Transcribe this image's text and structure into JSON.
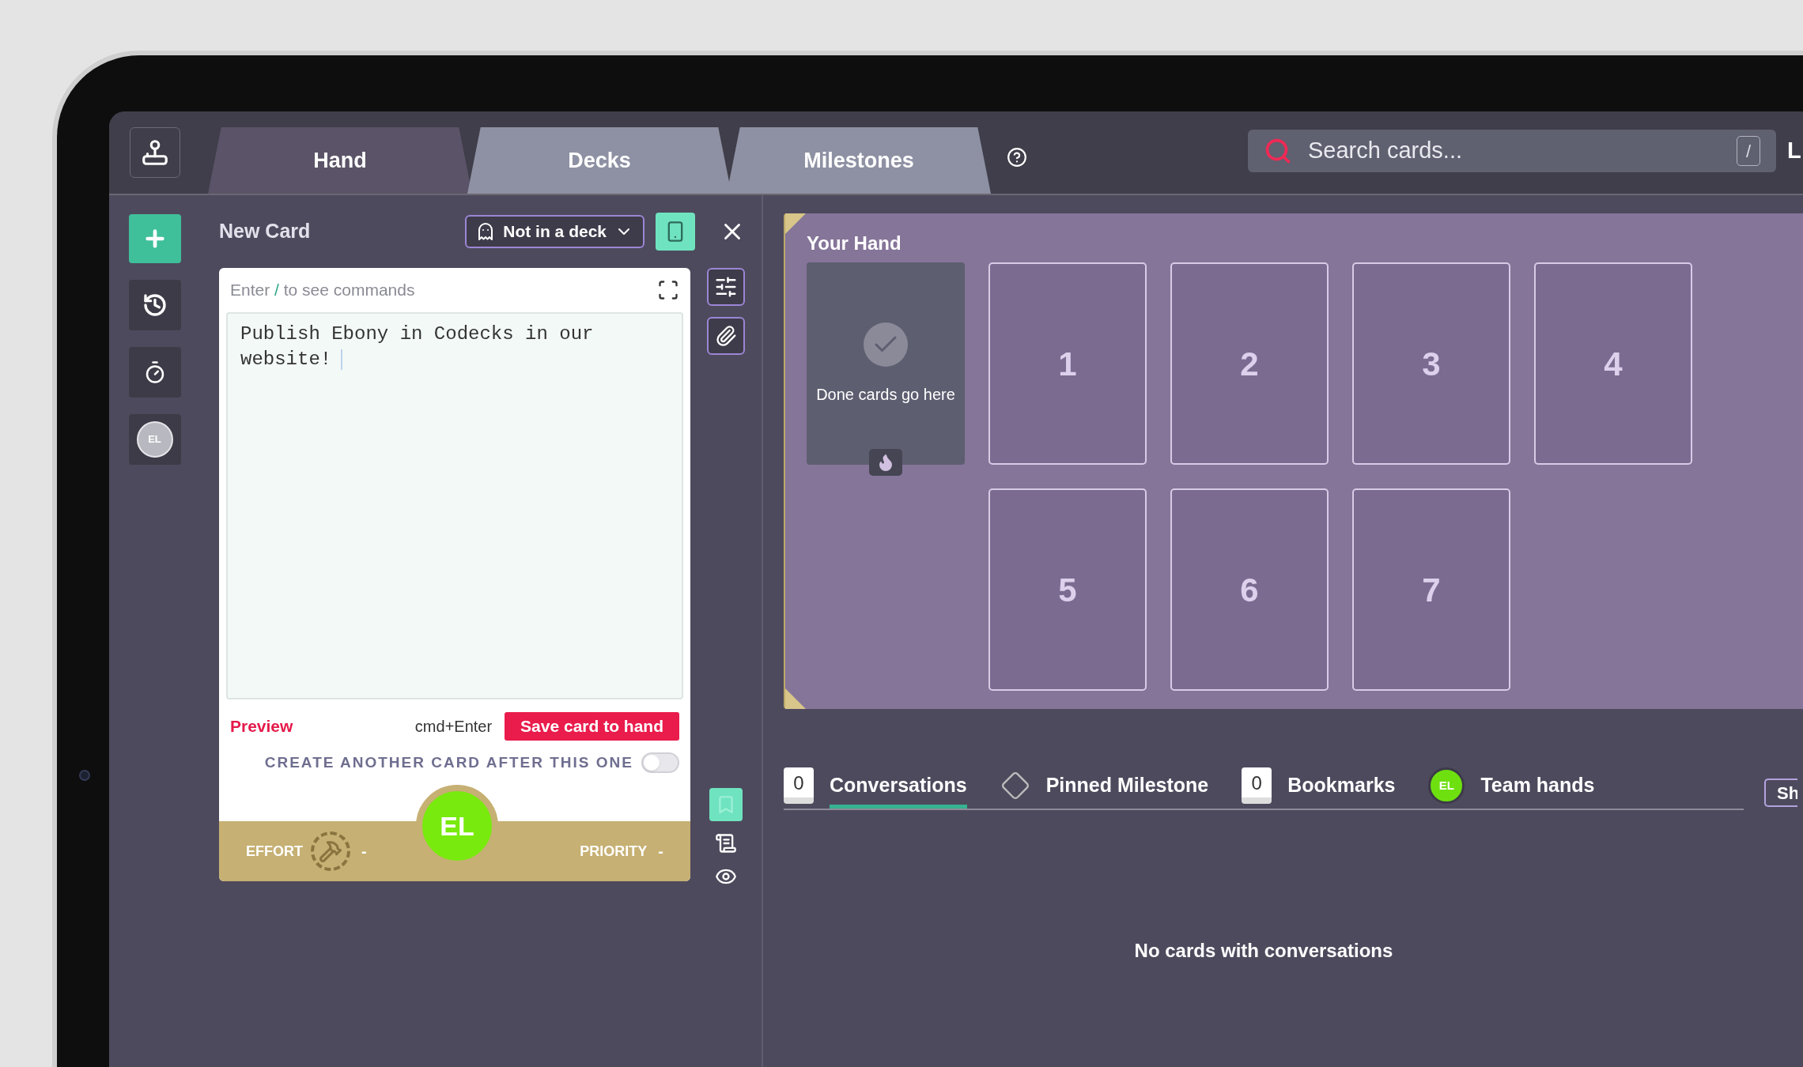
{
  "top_bar": {
    "tabs": [
      {
        "label": "Hand",
        "selected": true
      },
      {
        "label": "Decks",
        "selected": false
      },
      {
        "label": "Milestones",
        "selected": false
      }
    ],
    "search": {
      "placeholder": "Search cards...",
      "shortcut": "/"
    },
    "clipped_label": "L"
  },
  "sidebar": {
    "avatar_initials": "EL"
  },
  "new_card": {
    "title": "New Card",
    "deck_select": "Not in a deck",
    "command_hint": {
      "prefix": "Enter",
      "key": "/",
      "suffix": "to see commands"
    },
    "text": "Publish Ebony in Codecks in our website!",
    "preview": "Preview",
    "shortcut": "cmd+Enter",
    "save_button": "Save card to hand",
    "create_another": {
      "label": "CREATE ANOTHER CARD AFTER THIS ONE",
      "on": false
    },
    "effort": {
      "label": "EFFORT",
      "value": "-"
    },
    "priority": {
      "label": "PRIORITY",
      "value": "-"
    },
    "assignee": "EL"
  },
  "hand": {
    "title": "Your Hand",
    "done_slot": "Done cards go here",
    "slots": [
      "1",
      "2",
      "3",
      "4",
      "5",
      "6",
      "7"
    ]
  },
  "bottom_tabs": [
    {
      "kind": "count",
      "badge": "0",
      "label": "Conversations",
      "selected": true
    },
    {
      "kind": "milestone",
      "label": "Pinned Milestone",
      "selected": false
    },
    {
      "kind": "count",
      "badge": "0",
      "label": "Bookmarks",
      "selected": false
    },
    {
      "kind": "avatar",
      "badge": "EL",
      "label": "Team hands",
      "selected": false
    }
  ],
  "clipped_button": "Sh",
  "empty_message": "No cards with conversations"
}
